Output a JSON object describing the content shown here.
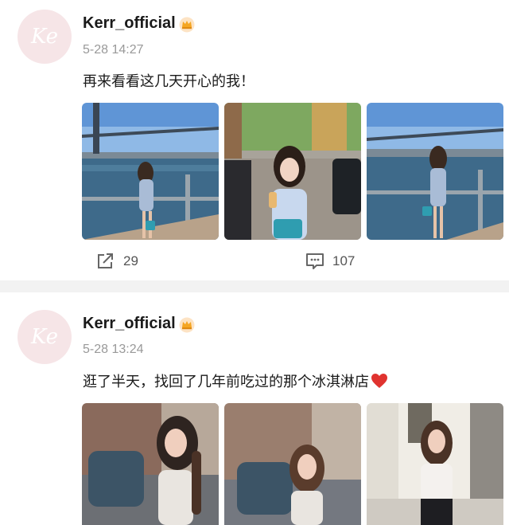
{
  "posts": [
    {
      "avatar_text": "Ke",
      "username": "Kerr_official",
      "time": "5-28 14:27",
      "text": "再来看看这几天开心的我！",
      "share_count": "29",
      "comment_count": "107"
    },
    {
      "avatar_text": "Ke",
      "username": "Kerr_official",
      "time": "5-28 13:24",
      "text": "逛了半天，找回了几年前吃过的那个冰淇淋店"
    }
  ],
  "icons": {
    "crown": "crown-badge-icon",
    "share": "share-icon",
    "comment": "comment-icon",
    "heart": "heart-emoji-icon"
  },
  "colors": {
    "heart": "#e0332f",
    "crown": "#f5a623",
    "avatar_bg": "#f6e5e7"
  }
}
